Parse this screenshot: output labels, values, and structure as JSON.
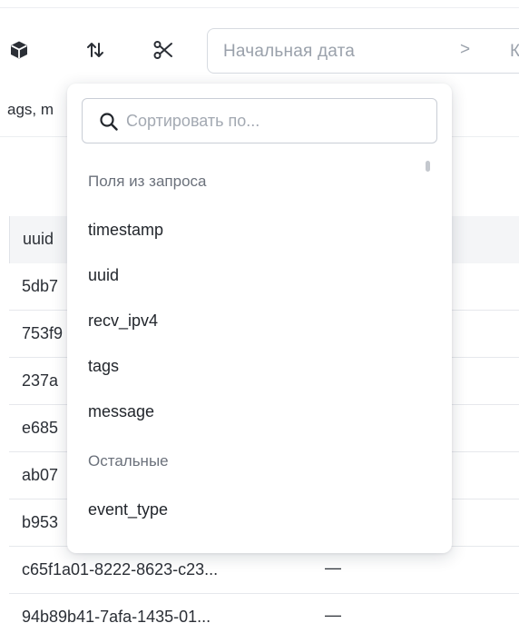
{
  "toolbar": {
    "icons": [
      "cube-icon",
      "sort-arrows-icon",
      "scissors-icon"
    ],
    "date_start_placeholder": "Начальная дата",
    "date_separator": ">",
    "date_end_placeholder": "К"
  },
  "filter": {
    "visible_text": "ags, m"
  },
  "table": {
    "column_header": "uuid",
    "rows": [
      {
        "uuid": "5db7",
        "value": ""
      },
      {
        "uuid": "753f9",
        "value": ""
      },
      {
        "uuid": "237a",
        "value": ""
      },
      {
        "uuid": "e685",
        "value": ""
      },
      {
        "uuid": "ab07",
        "value": ""
      },
      {
        "uuid": "b953",
        "value": ""
      },
      {
        "uuid": "c65f1a01-8222-8623-c23...",
        "value": "—"
      },
      {
        "uuid": "94b89b41-7afa-1435-01...",
        "value": "—"
      }
    ]
  },
  "sort_dropdown": {
    "search_placeholder": "Сортировать по...",
    "group_query_fields": "Поля из запроса",
    "query_fields": [
      "timestamp",
      "uuid",
      "recv_ipv4",
      "tags",
      "message"
    ],
    "group_other": "Остальные",
    "other_fields": [
      "event_type"
    ]
  }
}
